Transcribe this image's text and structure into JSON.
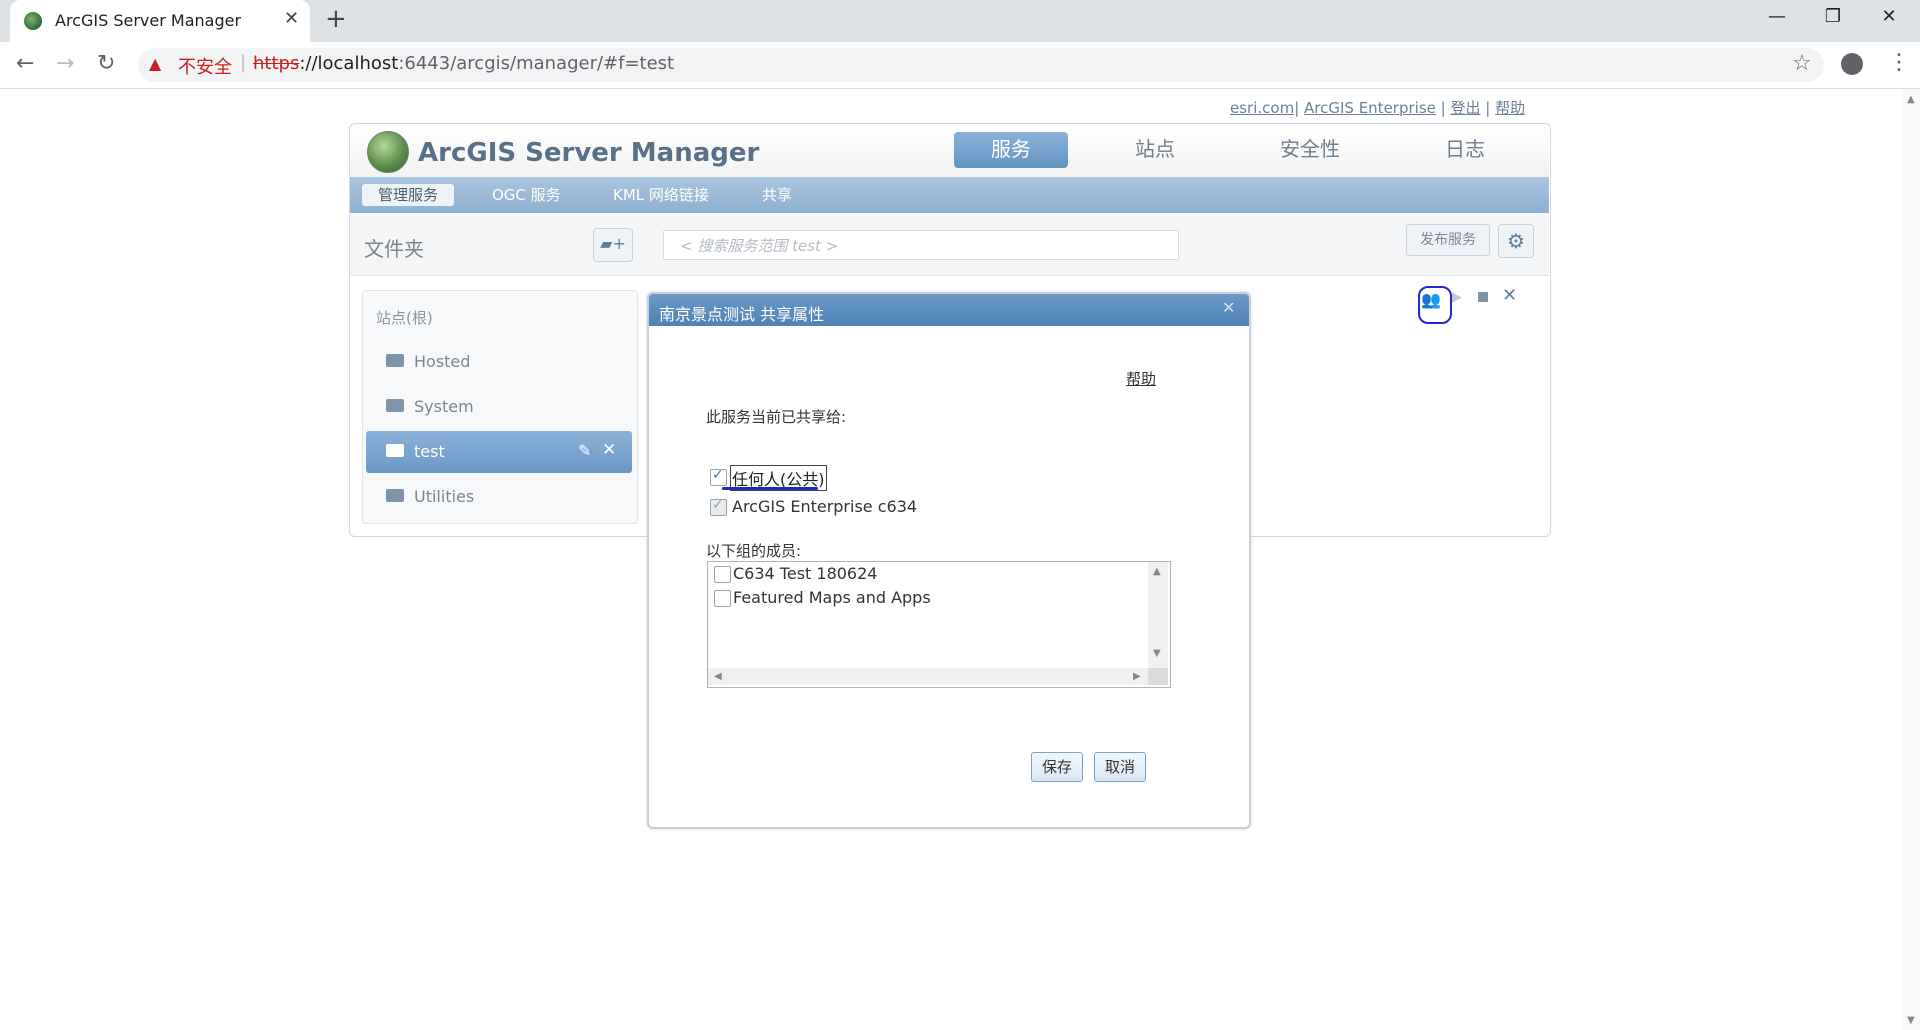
{
  "browser": {
    "tab_title": "ArcGIS Server Manager",
    "new_tab": "+",
    "insecure_label": "不安全",
    "url_scheme": "https",
    "url_host": "://localhost",
    "url_rest": ":6443/arcgis/manager/#f=test"
  },
  "toplinks": {
    "esri": "esri.com",
    "enterprise": "ArcGIS Enterprise",
    "logout": "登出",
    "help": "帮助"
  },
  "header": {
    "app_title": "ArcGIS Server Manager",
    "nav": [
      "服务",
      "站点",
      "安全性",
      "日志"
    ]
  },
  "subnav": [
    "管理服务",
    "OGC 服务",
    "KML 网络链接",
    "共享"
  ],
  "folderbar": {
    "label": "文件夹",
    "search_placeholder": "< 搜索服务范围 test >",
    "publish": "发布服务"
  },
  "sidebar": {
    "root": "站点(根)",
    "folders": [
      "Hosted",
      "System",
      "test",
      "Utilities"
    ]
  },
  "dialog": {
    "title": "南京景点测试 共享属性",
    "help": "帮助",
    "shared_label": "此服务当前已共享给:",
    "everyone": "任何人(公共)",
    "enterprise": "ArcGIS Enterprise c634",
    "members_label": "以下组的成员:",
    "groups": [
      "C634 Test 180624",
      "Featured Maps and Apps"
    ],
    "save": "保存",
    "cancel": "取消"
  }
}
